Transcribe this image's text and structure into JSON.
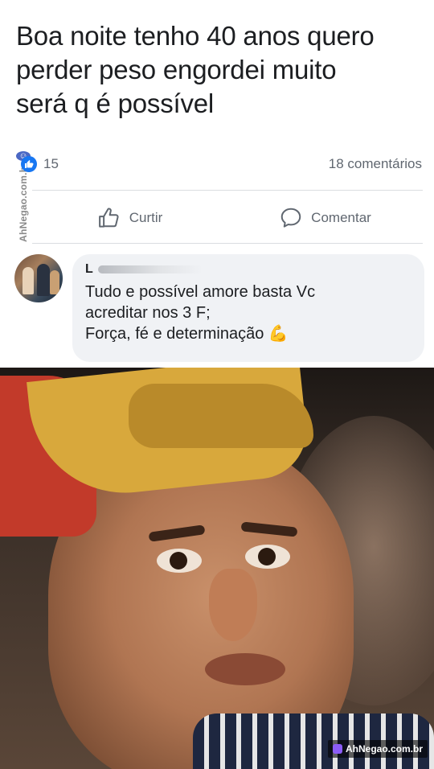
{
  "post": {
    "text": "Boa noite  tenho 40 anos quero\nperder peso  engordei muito\nserá q é possível"
  },
  "watermark_side": {
    "text": "AhNegao.com.br"
  },
  "stats": {
    "likes_count": "15",
    "comments_count": "18 comentários"
  },
  "actions": {
    "like_label": "Curtir",
    "comment_label": "Comentar"
  },
  "comment": {
    "author_visible": "L",
    "text": "Tudo e possível amore basta Vc\nacreditar nos 3 F;\nForça, fé e determinação 💪"
  },
  "watermark_bottom": {
    "text": "AhNegao.com.br"
  },
  "colors": {
    "like_blue": "#1877f2",
    "bubble_bg": "#f0f2f5",
    "secondary_text": "#606770"
  }
}
